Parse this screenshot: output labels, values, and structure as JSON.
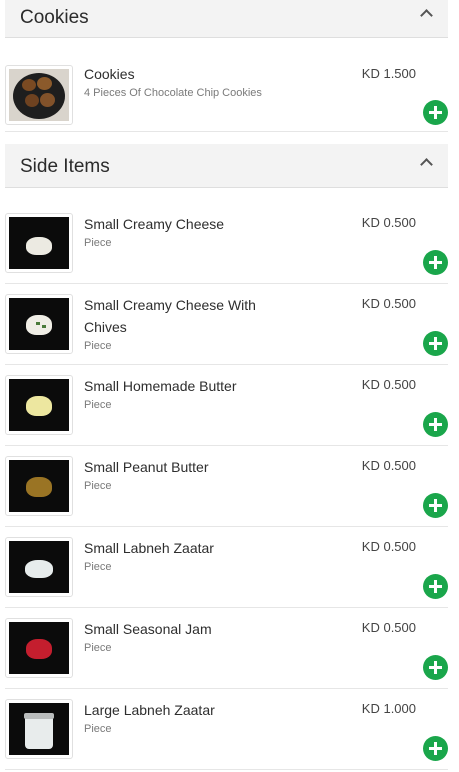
{
  "sections": [
    {
      "title": "Cookies"
    },
    {
      "title": "Side Items"
    }
  ],
  "cookies": {
    "name": "Cookies",
    "desc": "4 Pieces Of Chocolate Chip Cookies",
    "price": "KD 1.500"
  },
  "side_items": [
    {
      "name": "Small Creamy Cheese",
      "desc": "Piece",
      "price": "KD 0.500"
    },
    {
      "name": "Small Creamy Cheese With Chives",
      "desc": "Piece",
      "price": "KD 0.500"
    },
    {
      "name": "Small Homemade Butter",
      "desc": "Piece",
      "price": "KD 0.500"
    },
    {
      "name": "Small Peanut Butter",
      "desc": "Piece",
      "price": "KD 0.500"
    },
    {
      "name": "Small Labneh Zaatar",
      "desc": "Piece",
      "price": "KD 0.500"
    },
    {
      "name": "Small Seasonal Jam",
      "desc": "Piece",
      "price": "KD 0.500"
    },
    {
      "name": "Large Labneh Zaatar",
      "desc": "Piece",
      "price": "KD 1.000"
    }
  ],
  "colors": {
    "add_button": "#1aa64b",
    "header_bg": "#f3f3f3"
  },
  "icons": {
    "collapse": "chevron-up-icon",
    "add": "plus-icon"
  }
}
